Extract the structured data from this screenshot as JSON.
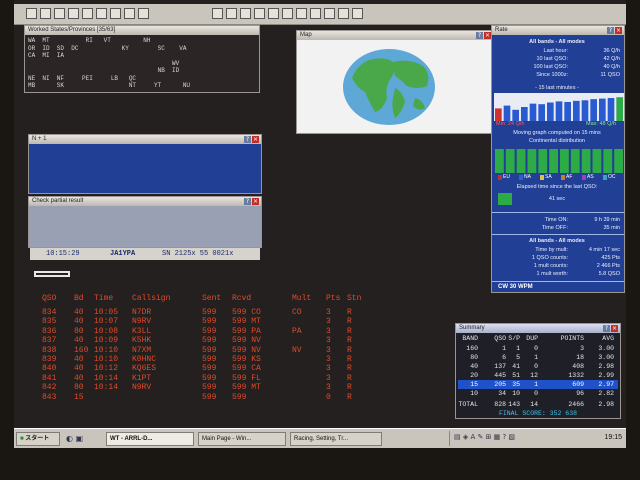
{
  "toolbar": {
    "icons": [
      "new",
      "open",
      "save",
      "print",
      "bandmap",
      "edit",
      "tools",
      "opt",
      "info",
      "help",
      "help2",
      "help3",
      "help4",
      "help5",
      "help6",
      "help7",
      "help8",
      "help9",
      "help10",
      "help11"
    ]
  },
  "worked": {
    "title": "Worked States/Provinces [35/63]",
    "rows": [
      "WA  MT          RI   VT         NH",
      "OR  ID  SD  DC            KY        SC    VA",
      "CA  MI  IA",
      "                                        WV",
      "                                    NB  ID",
      "NE  NI  NF     PEI     LB   QC",
      "MB      SK                  NT     YT      NU"
    ]
  },
  "map": {
    "title": "Map"
  },
  "rate": {
    "title": "Rate",
    "heading": "All bands - All modes",
    "lines": [
      {
        "label": "Last hour:",
        "value": "36 Q/h"
      },
      {
        "label": "10 last QSO:",
        "value": "42 Q/h"
      },
      {
        "label": "100 last QSO:",
        "value": "40 Q/h"
      },
      {
        "label": "Since 1000z:",
        "value": "11 QSO"
      }
    ],
    "minutes_label": "- 15 last minutes -",
    "bars": [
      0.45,
      0.55,
      0.4,
      0.5,
      0.62,
      0.6,
      0.66,
      0.7,
      0.68,
      0.72,
      0.74,
      0.78,
      0.8,
      0.82,
      0.85
    ],
    "min_label": "Min: 24 Q/h",
    "max_label": "Max: 48 Q/h",
    "moving": "Moving graph computed on 15 mins",
    "continental": "Continental distribution",
    "continents": [
      "EU",
      "NA",
      "SA",
      "AF",
      "AS",
      "OC"
    ],
    "elapsed_label": "Elapsed time since the last QSO:",
    "elapsed_value": "41 sec",
    "time_on_label": "Time ON:",
    "time_on": "9 h 39 min",
    "time_off_label": "Time OFF:",
    "time_off": "35 min",
    "heading2": "All bands - All modes",
    "mult_lines": [
      {
        "label": "Time by mult:",
        "value": "4 min 17 sec"
      },
      {
        "label": "1 QSO counts:",
        "value": "425 Pts"
      },
      {
        "label": "1 mult counts:",
        "value": "2 466 Pts"
      },
      {
        "label": "1 mult worth:",
        "value": "5.8 QSO"
      }
    ],
    "cw": "CW  30 WPM"
  },
  "n1": {
    "title": "N + 1"
  },
  "partial": {
    "title": "Check partial result"
  },
  "status": {
    "time": "10:15:29",
    "call": "JA1YPA",
    "info": "SN 2125x 55 0021x"
  },
  "log": {
    "headers": [
      "QSO",
      "Bd",
      "Time",
      "Callsign",
      "Sent",
      "Rcvd",
      "Mult",
      "Pts",
      "Stn"
    ],
    "rows": [
      [
        "834",
        "40",
        "10:05",
        "N7DR",
        "599",
        "599 CO",
        "CO",
        "3",
        "R"
      ],
      [
        "835",
        "40",
        "10:07",
        "N9RV",
        "599",
        "599 MT",
        "",
        "3",
        "R"
      ],
      [
        "836",
        "80",
        "10:08",
        "K3LL",
        "599",
        "599 PA",
        "PA",
        "3",
        "R"
      ],
      [
        "837",
        "40",
        "10:09",
        "K5HK",
        "599",
        "599 NV",
        "",
        "3",
        "R"
      ],
      [
        "838",
        "160",
        "10:10",
        "N7XM",
        "599",
        "599 NV",
        "NV",
        "3",
        "R"
      ],
      [
        "839",
        "40",
        "10:10",
        "K0HNC",
        "599",
        "599 KS",
        "",
        "3",
        "R"
      ],
      [
        "840",
        "40",
        "10:12",
        "KQ6ES",
        "599",
        "599 CA",
        "",
        "3",
        "R"
      ],
      [
        "841",
        "40",
        "10:14",
        "K1PT",
        "599",
        "599 FL",
        "",
        "3",
        "R"
      ],
      [
        "842",
        "80",
        "10:14",
        "N9RV",
        "599",
        "599 MT",
        "",
        "3",
        "R"
      ],
      [
        "843",
        "15",
        "",
        "",
        "599",
        "599",
        "",
        "0",
        "R"
      ]
    ]
  },
  "summary": {
    "title": "Summary",
    "headers": [
      "BAND",
      "QSO",
      "S/P",
      "DUP",
      "POINTS",
      "AVG"
    ],
    "rows": [
      [
        "160",
        "1",
        "1",
        "0",
        "3",
        "3.00"
      ],
      [
        "80",
        "6",
        "5",
        "1",
        "18",
        "3.00"
      ],
      [
        "40",
        "137",
        "41",
        "0",
        "408",
        "2.98"
      ],
      [
        "20",
        "445",
        "51",
        "12",
        "1332",
        "2.99"
      ],
      [
        "15",
        "205",
        "35",
        "1",
        "609",
        "2.97"
      ],
      [
        "10",
        "34",
        "10",
        "0",
        "96",
        "2.82"
      ]
    ],
    "total": [
      "TOTAL",
      "828",
      "143",
      "14",
      "2466",
      "2.98"
    ],
    "final": "FINAL SCORE: 352 638"
  },
  "taskbar": {
    "start": "スタート",
    "tasks": [
      "WT - ARRL-D...",
      "Main Page - Win...",
      "Racing, Setting, Tr..."
    ],
    "clock": "19:15"
  },
  "colors": {
    "bg": "#23201f",
    "log_red": "#e04a2a",
    "panel_blue": "#1d3e9a",
    "bar_green": "#2cab46"
  }
}
